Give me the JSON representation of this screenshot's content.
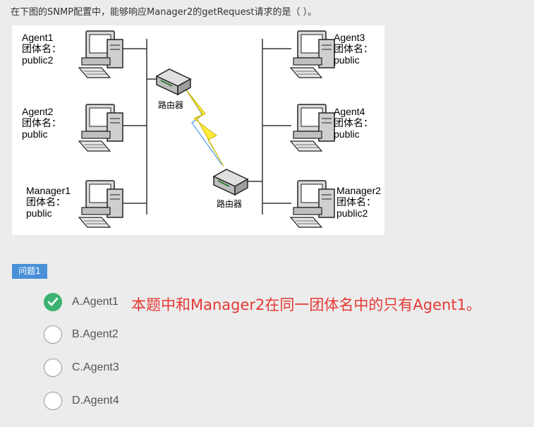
{
  "question": "在下图的SNMP配置中，能够响应Manager2的getRequest请求的是（ ）。",
  "figure": {
    "agent1": {
      "name": "Agent1",
      "community_label": "团体名：",
      "community": "public2"
    },
    "agent2": {
      "name": "Agent2",
      "community_label": "团体名：",
      "community": "public"
    },
    "manager1": {
      "name": "Manager1",
      "community_label": "团体名：",
      "community": "public"
    },
    "agent3": {
      "name": "Agent3",
      "community_label": "团体名：",
      "community": "public"
    },
    "agent4": {
      "name": "Agent4",
      "community_label": "团体名：",
      "community": "public"
    },
    "manager2": {
      "name": "Manager2",
      "community_label": "团体名：",
      "community": "public2"
    },
    "router_label": "路由器"
  },
  "tag": "问题1",
  "options": [
    {
      "label": "A.Agent1",
      "selected": true
    },
    {
      "label": "B.Agent2",
      "selected": false
    },
    {
      "label": "C.Agent3",
      "selected": false
    },
    {
      "label": "D.Agent4",
      "selected": false
    }
  ],
  "note": "本题中和Manager2在同一团体名中的只有Agent1。",
  "colors": {
    "tag": "#4a90d9",
    "correct": "#3cb371",
    "note": "#e53935"
  }
}
